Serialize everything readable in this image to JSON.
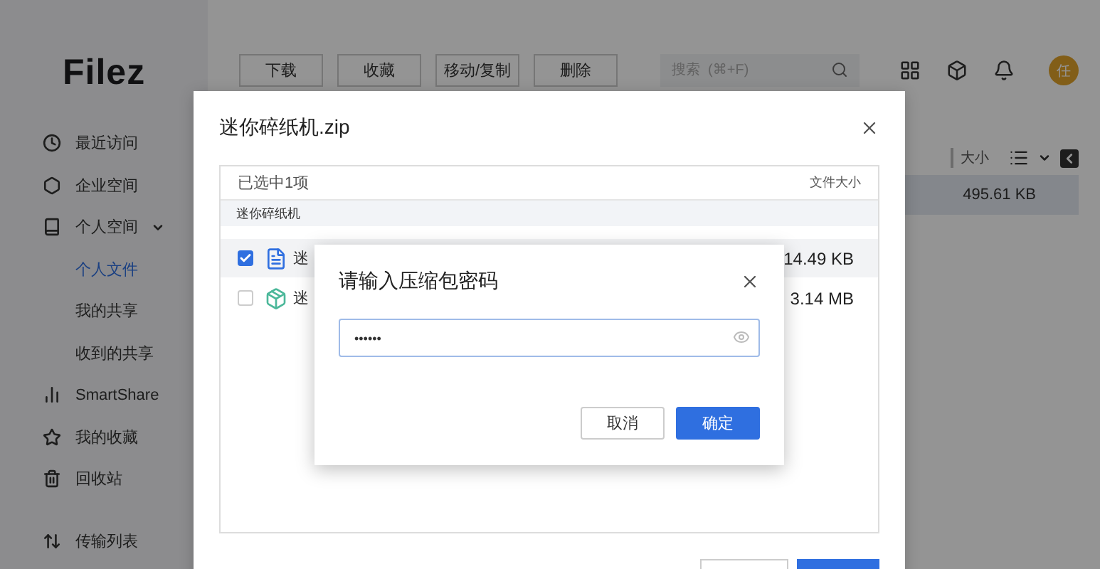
{
  "sidebar": {
    "logo": "Filez",
    "items": [
      {
        "label": "最近访问",
        "selected": false
      },
      {
        "label": "企业空间",
        "selected": false
      },
      {
        "label": "个人空间",
        "selected": false,
        "expanded": true,
        "children": [
          {
            "label": "个人文件",
            "selected": true
          },
          {
            "label": "我的共享",
            "selected": false
          },
          {
            "label": "收到的共享",
            "selected": false
          }
        ]
      },
      {
        "label": "SmartShare",
        "selected": false
      },
      {
        "label": "我的收藏",
        "selected": false
      },
      {
        "label": "回收站",
        "selected": false
      }
    ],
    "bottom_item": {
      "label": "传输列表"
    }
  },
  "toolbar": {
    "buttons": [
      "下载",
      "收藏",
      "移动/复制",
      "删除"
    ],
    "search": {
      "placeholder": "搜索  (⌘+F)"
    },
    "avatar": "任"
  },
  "file_list": {
    "sort_label": "大小",
    "rows": [
      {
        "size": "495.61 KB",
        "selected": true
      }
    ]
  },
  "archive_dialog": {
    "title": "迷你碎纸机.zip",
    "selection_count": "已选中1项",
    "size_column": "文件大小",
    "breadcrumb": "迷你碎纸机",
    "files": [
      {
        "name": "迷",
        "size": "14.49 KB",
        "kind": "document",
        "checked": true,
        "selected": true
      },
      {
        "name": "迷",
        "size": "3.14 MB",
        "kind": "package",
        "checked": false,
        "selected": false
      }
    ],
    "footer_buttons": [
      {
        "kind": "secondary"
      },
      {
        "kind": "primary"
      }
    ]
  },
  "password_dialog": {
    "title": "请输入压缩包密码",
    "value": "••••••",
    "buttons": [
      {
        "label": "取消",
        "kind": "secondary"
      },
      {
        "label": "确定",
        "kind": "primary"
      }
    ]
  }
}
